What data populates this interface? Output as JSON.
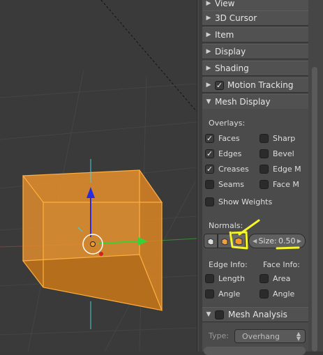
{
  "colors": {
    "viewport_bg": "#3a3a3a",
    "panel_bg": "#464646",
    "object_orange": "#f39a2c",
    "annotation_yellow": "#f5f52a",
    "axis_red": "#b04040",
    "axis_green": "#3fb03f"
  },
  "panels": {
    "view": "View",
    "cursor": "3D Cursor",
    "item": "Item",
    "display": "Display",
    "shading": "Shading",
    "motion_tracking": "Motion Tracking",
    "mesh_display": "Mesh Display",
    "mesh_analysis": "Mesh Analysis"
  },
  "mesh_display": {
    "overlays_label": "Overlays:",
    "overlays": [
      {
        "label": "Faces",
        "checked": true
      },
      {
        "label": "Sharp",
        "checked": false
      },
      {
        "label": "Edges",
        "checked": true
      },
      {
        "label": "Bevel",
        "checked": false
      },
      {
        "label": "Creases",
        "checked": true
      },
      {
        "label": "Edge M",
        "checked": false
      },
      {
        "label": "Seams",
        "checked": false
      },
      {
        "label": "Face M",
        "checked": false
      }
    ],
    "show_weights": "Show Weights",
    "normals_label": "Normals:",
    "size_label": "Size:",
    "size_value": "0.50",
    "edge_info_label": "Edge Info:",
    "face_info_label": "Face Info:",
    "edge_info": [
      "Length",
      "Angle"
    ],
    "face_info": [
      "Area",
      "Angle"
    ]
  },
  "mesh_analysis": {
    "type_label": "Type:",
    "type_value": "Overhang"
  },
  "icons": {
    "collapsed": "triangle-right",
    "expanded": "triangle-down",
    "checkmark": "check"
  }
}
